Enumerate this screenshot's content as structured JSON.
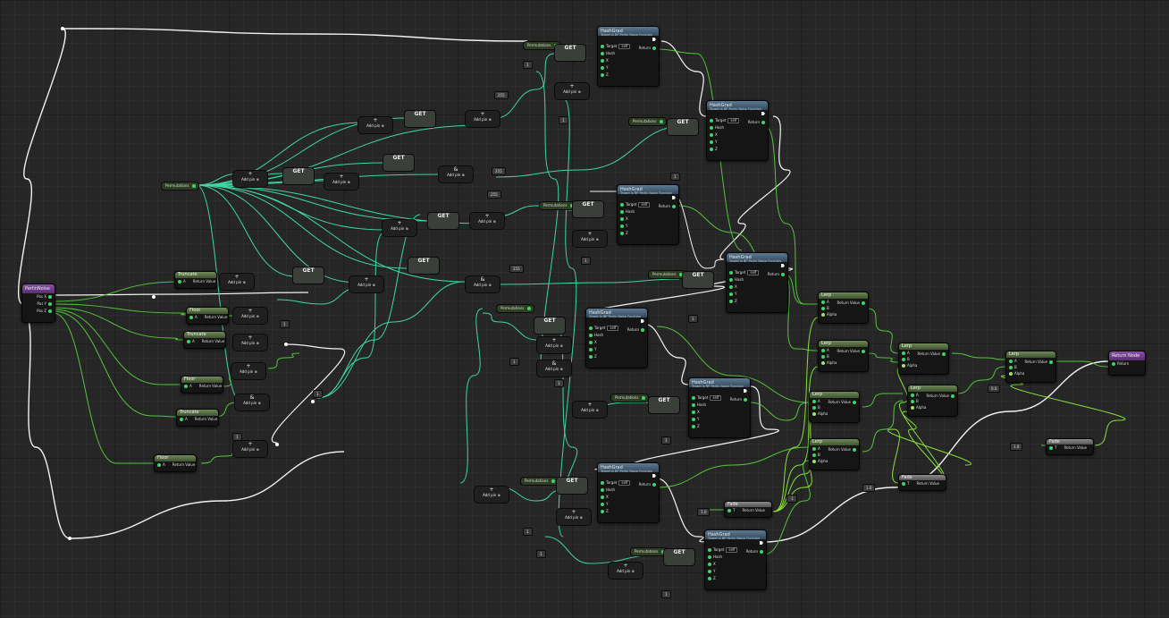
{
  "graph": {
    "function_entry": {
      "title": "PerlinNoise",
      "pins": [
        "Pos X",
        "Pos Y",
        "Pos Z"
      ]
    },
    "return_node": {
      "title": "Return Node",
      "pin": "Return"
    },
    "perm_var": "Permutations",
    "get_label": "GET",
    "add_pin": "Add pin",
    "hash_node": {
      "title": "HashGrad",
      "subtitle": "Target is BP Perlin Noise Function",
      "pins": [
        "Target",
        "Hash",
        "X",
        "Y",
        "Z"
      ],
      "out": "Return",
      "target_value": "self"
    },
    "floor_nodes": [
      {
        "title": "Truncate",
        "in": "A",
        "out": "Return Value"
      },
      {
        "title": "Floor",
        "in": "A",
        "out": "Return Value"
      },
      {
        "title": "Truncate",
        "in": "A",
        "out": "Return Value"
      },
      {
        "title": "Floor",
        "in": "A",
        "out": "Return Value"
      },
      {
        "title": "Truncate",
        "in": "A",
        "out": "Return Value"
      },
      {
        "title": "Floor",
        "in": "A",
        "out": "Return Value"
      }
    ],
    "lerp_node": {
      "title": "Lerp",
      "pins": [
        "A",
        "B",
        "Alpha"
      ],
      "out": "Return Value"
    },
    "fade_node": {
      "title": "Fade",
      "in": "T",
      "out": "Return Value"
    },
    "literal_values": [
      "255",
      "1",
      "0.0",
      "1.0",
      "-1"
    ]
  }
}
